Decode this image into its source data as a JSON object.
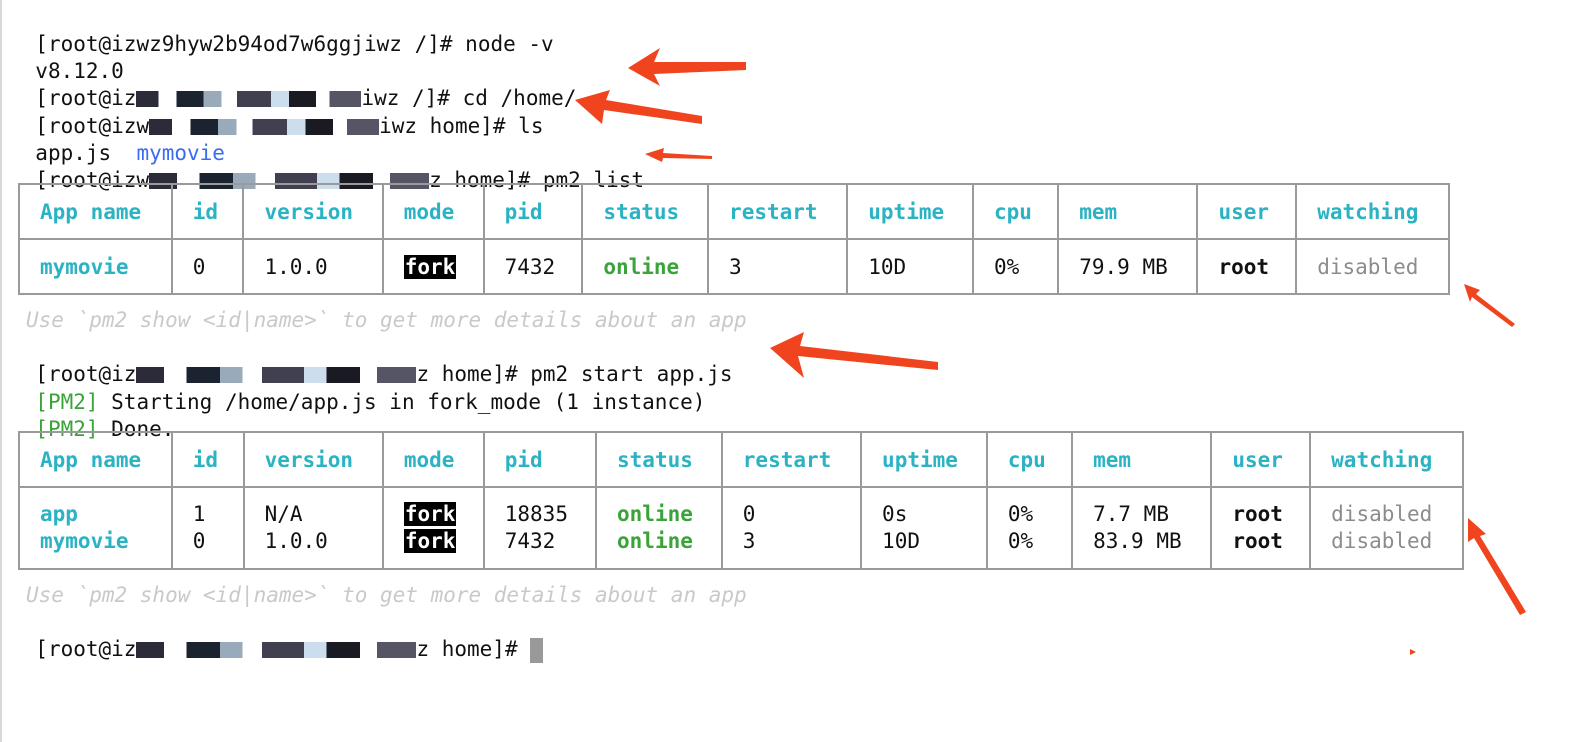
{
  "terminal": {
    "lines": [
      {
        "prompt": "[root@izwz9hyw2b94od7w6ggjiwz /]# ",
        "text": "node -v"
      },
      {
        "text": "v8.12.0"
      },
      {
        "prompt_a": "[root@iz",
        "prompt_b": "iwz /]# ",
        "text": "cd /home/"
      },
      {
        "prompt_a": "[root@izw",
        "prompt_b": "iwz home]# ",
        "text": "ls"
      },
      {
        "file1": "app.js",
        "dir1": "mymovie"
      },
      {
        "prompt_a": "[root@izw",
        "prompt_b": "z home]# ",
        "text": "pm2 list"
      }
    ],
    "hint": "Use `pm2 show <id|name>` to get more details about an app",
    "start_cmd": {
      "prompt_a": "[root@iz",
      "prompt_b": "z home]# ",
      "text": "pm2 start app.js"
    },
    "pm2_msg1": {
      "tag": "[PM2]",
      "text": " Starting /home/app.js in fork_mode (1 instance)"
    },
    "pm2_msg2": {
      "tag": "[PM2]",
      "text": " Done."
    },
    "final_prompt": {
      "prompt_a": "[root@iz",
      "prompt_b": "z home]# "
    }
  },
  "table_headers": [
    "App name",
    "id",
    "version",
    "mode",
    "pid",
    "status",
    "restart",
    "uptime",
    "cpu",
    "mem",
    "user",
    "watching"
  ],
  "table1": {
    "rows": [
      {
        "name": "mymovie",
        "id": "0",
        "version": "1.0.0",
        "mode": "fork",
        "pid": "7432",
        "status": "online",
        "restart": "3",
        "uptime": "10D",
        "cpu": "0%",
        "mem": "79.9 MB",
        "user": "root",
        "watching": "disabled"
      }
    ]
  },
  "table2": {
    "rows": [
      {
        "name": "app",
        "id": "1",
        "version": "N/A",
        "mode": "fork",
        "pid": "18835",
        "status": "online",
        "restart": "0",
        "uptime": "0s",
        "cpu": "0%",
        "mem": "7.7 MB",
        "user": "root",
        "watching": "disabled"
      },
      {
        "name": "mymovie",
        "id": "0",
        "version": "1.0.0",
        "mode": "fork",
        "pid": "7432",
        "status": "online",
        "restart": "3",
        "uptime": "10D",
        "cpu": "0%",
        "mem": "83.9 MB",
        "user": "root",
        "watching": "disabled"
      }
    ]
  },
  "colors": {
    "accent": "#2bb3c4",
    "online": "#3aa33a",
    "arrow": "#f0441e",
    "dir": "#3b6cf0"
  }
}
